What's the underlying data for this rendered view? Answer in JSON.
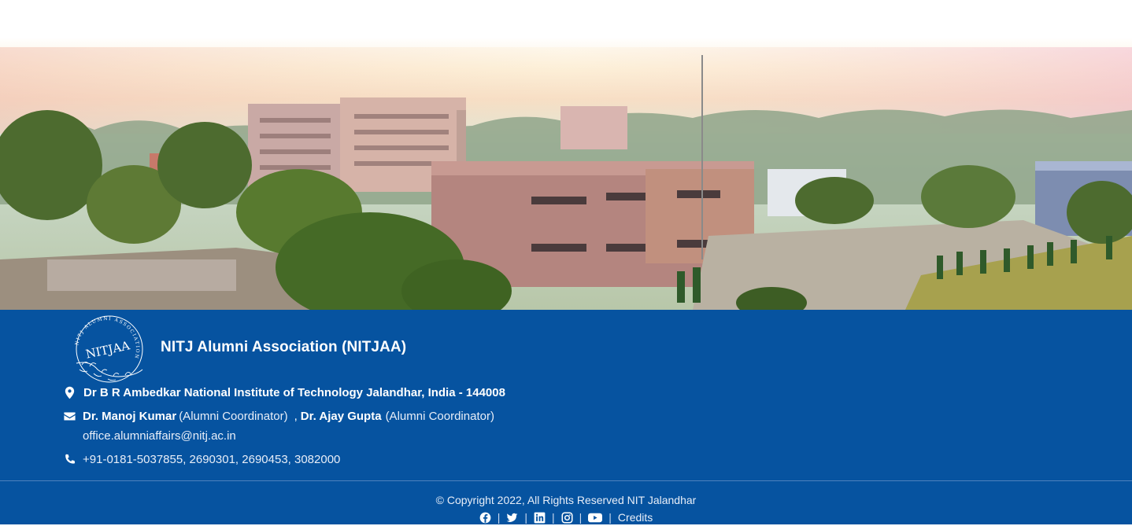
{
  "footer": {
    "org_name": "NITJ Alumni Association (NITJAA)",
    "logo_text": "NITJAA",
    "logo_ring_text": "NITJ ALUMNI ASSOCIATION",
    "address": "Dr B R Ambedkar National Institute of Technology Jalandhar, India - 144008",
    "contact1_name": "Dr. Manoj Kumar",
    "contact1_role": "(Alumni Coordinator)",
    "contact_separator": ",",
    "contact2_name": "Dr. Ajay Gupta",
    "contact2_role": "(Alumni Coordinator)",
    "email": "office.alumniaffairs@nitj.ac.in",
    "phone": "+91-0181-5037855, 2690301, 2690453, 3082000",
    "copyright": "© Copyright 2022, All Rights Reserved NIT Jalandhar",
    "credits_label": "Credits",
    "social_separator": "|"
  },
  "social_icons": [
    "facebook-icon",
    "twitter-icon",
    "linkedin-icon",
    "instagram-icon",
    "youtube-icon"
  ],
  "colors": {
    "footer_bg": "#0653a0",
    "text": "#ffffff",
    "divider": "#4d82bd"
  }
}
